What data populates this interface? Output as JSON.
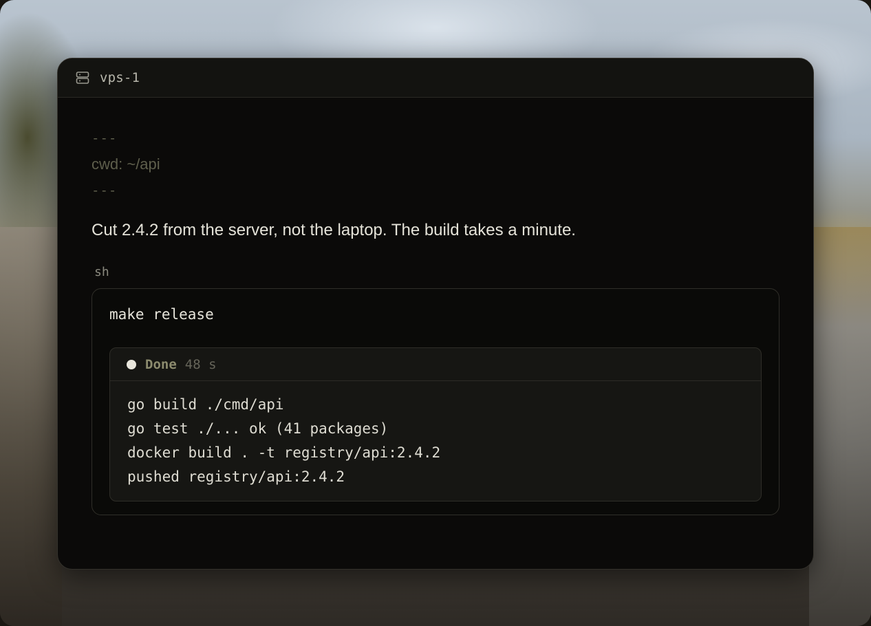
{
  "window": {
    "title": "vps-1",
    "icon": "server-icon"
  },
  "frontmatter": {
    "open_delimiter": "---",
    "cwd": "cwd: ~/api",
    "close_delimiter": "---"
  },
  "message": "Cut 2.4.2 from the server, not the laptop. The build takes a minute.",
  "code_block": {
    "language": "sh",
    "command": "make release",
    "run": {
      "status": "Done",
      "duration": "48 s",
      "status_icon": "status-dot-icon",
      "status_color": "#e8e6dc"
    },
    "output": [
      "go build ./cmd/api",
      "go test ./... ok (41 packages)",
      "docker build . -t registry/api:2.4.2",
      "pushed registry/api:2.4.2"
    ]
  }
}
